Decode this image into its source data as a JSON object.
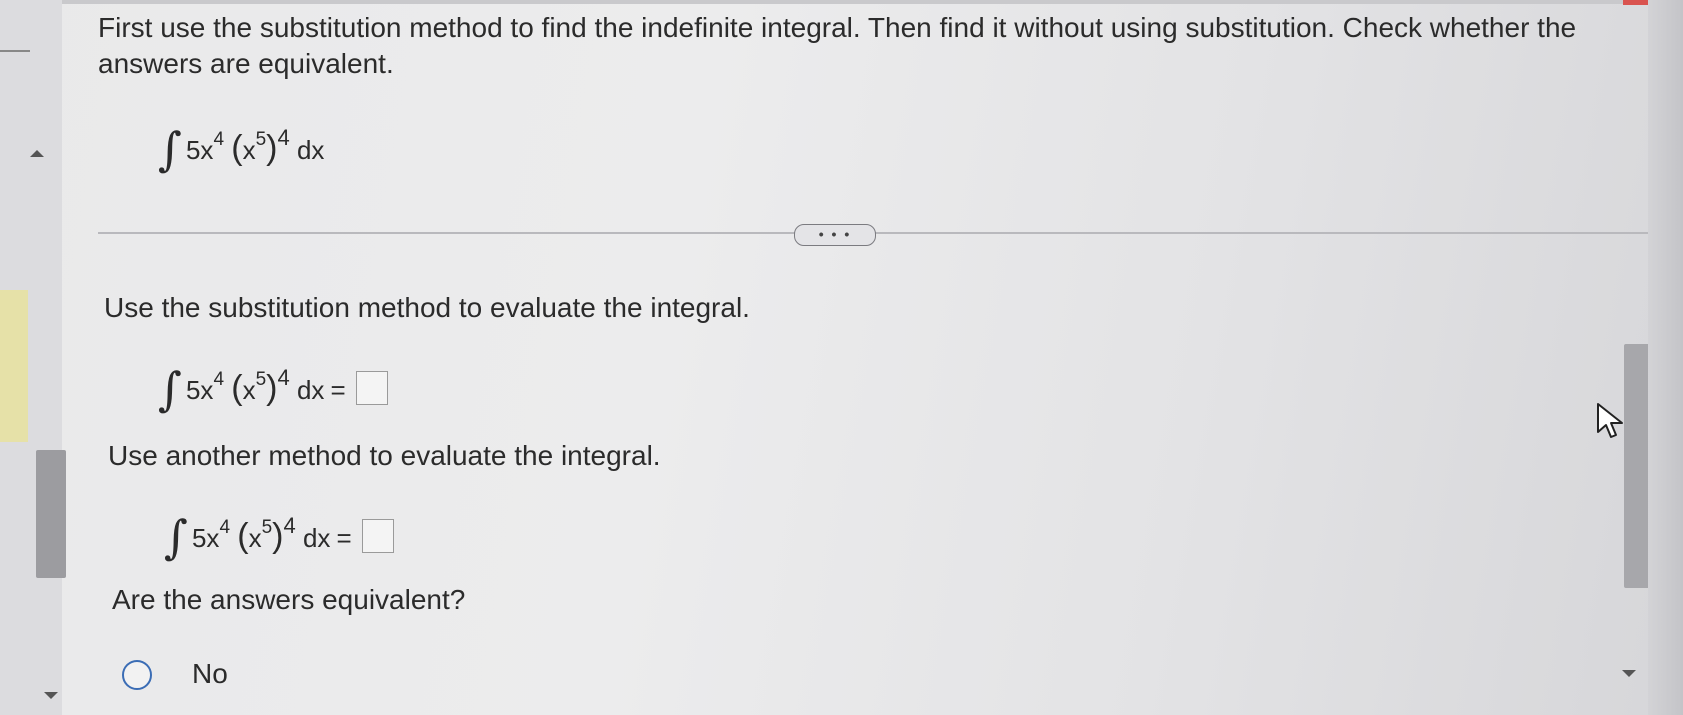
{
  "question": {
    "intro": "First use the substitution method to find the indefinite integral. Then find it without using substitution. Check whether the answers are equivalent."
  },
  "integral": {
    "integrand_coef": "5x",
    "exp_inner": "4",
    "paren_open": "(",
    "paren_base": "x",
    "paren_exp": "5",
    "paren_close": ")",
    "outer_exp": "4",
    "dx": "dx",
    "equals": "="
  },
  "expand_button": {
    "label": "• • •"
  },
  "parts": {
    "substitution_prompt": "Use the substitution method to evaluate the integral.",
    "another_prompt": "Use another method to evaluate the integral.",
    "equivalent_prompt": "Are the answers equivalent?"
  },
  "options": {
    "no_label": "No"
  },
  "colors": {
    "radio_border": "#3b6db5",
    "highlight": "#e6e1a8"
  }
}
